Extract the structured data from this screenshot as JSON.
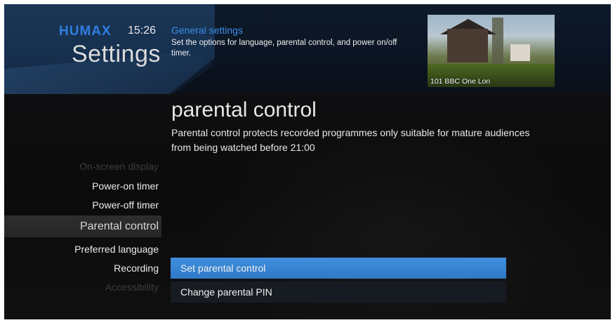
{
  "header": {
    "brand": "HUMAX",
    "time": "15:26",
    "title": "Settings",
    "section_title": "General settings",
    "section_description": "Set the options for language, parental control, and power on/off timer."
  },
  "preview": {
    "channel_label": "101 BBC One Lon"
  },
  "detail": {
    "title": "parental control",
    "description": "Parental control protects recorded programmes only suitable for mature audiences from being watched before 21:00"
  },
  "menu": {
    "items": [
      {
        "label": "On-screen display",
        "state": "dim"
      },
      {
        "label": "Power-on timer",
        "state": "normal"
      },
      {
        "label": "Power-off timer",
        "state": "normal"
      },
      {
        "label": "Parental control",
        "state": "selected"
      },
      {
        "label": "Preferred language",
        "state": "normal"
      },
      {
        "label": "Recording",
        "state": "normal"
      },
      {
        "label": "Accessibility",
        "state": "dim"
      }
    ]
  },
  "options": [
    {
      "label": "Set parental control",
      "state": "active"
    },
    {
      "label": "Change parental PIN",
      "state": "inactive"
    }
  ],
  "colors": {
    "accent_blue": "#3d8ee8",
    "brand_blue": "#2f7ee0",
    "highlight_blue": "#3a87d6"
  }
}
